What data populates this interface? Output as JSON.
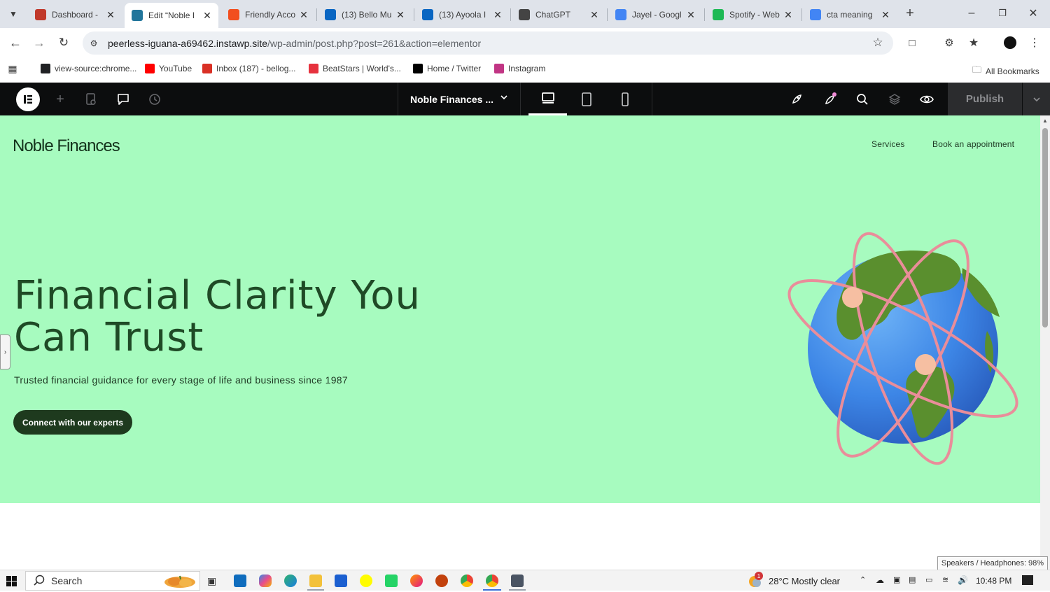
{
  "browser": {
    "tabs": [
      {
        "title": "Dashboard -",
        "icon": "wordpress-dashboard-icon",
        "color": "#c0392b"
      },
      {
        "title": "Edit “Noble I",
        "icon": "wordpress-icon",
        "color": "#21759b",
        "active": true
      },
      {
        "title": "Friendly Acco",
        "icon": "figma-icon",
        "color": "#f24e1e"
      },
      {
        "title": "(13) Bello Mu",
        "icon": "linkedin-icon",
        "color": "#0a66c2"
      },
      {
        "title": "(13) Ayoola I",
        "icon": "linkedin-icon",
        "color": "#0a66c2"
      },
      {
        "title": "ChatGPT",
        "icon": "chatgpt-icon",
        "color": "#444444"
      },
      {
        "title": "Jayel - Googl",
        "icon": "google-docs-icon",
        "color": "#4285f4"
      },
      {
        "title": "Spotify - Web",
        "icon": "spotify-icon",
        "color": "#1db954"
      },
      {
        "title": "cta meaning",
        "icon": "google-icon",
        "color": "#4285f4"
      }
    ],
    "url_host": "peerless-iguana-a69462.instawp.site",
    "url_path": "/wp-admin/post.php?post=261&action=elementor",
    "bookmarks": [
      {
        "label": "view-source:chrome...",
        "color": "#202124"
      },
      {
        "label": "YouTube",
        "color": "#ff0000"
      },
      {
        "label": "Inbox (187) - bellog...",
        "color": "#d93025"
      },
      {
        "label": "BeatStars | World's...",
        "color": "#e6323e"
      },
      {
        "label": "Home / Twitter",
        "color": "#000000"
      },
      {
        "label": "Instagram",
        "color": "#c13584"
      }
    ],
    "all_bookmarks": "All Bookmarks"
  },
  "elementor": {
    "document_name": "Noble Finances ...",
    "publish_label": "Publish"
  },
  "site": {
    "logo": "Noble Finances",
    "nav": [
      "Services",
      "Book an appointment"
    ],
    "headline": "Financial Clarity You Can Trust",
    "subheading": "Trusted financial guidance for every stage of life and business since 1987",
    "cta_label": "Connect with our experts",
    "hero_bg": "#a7fbbf",
    "cta_bg": "#1e3a1e"
  },
  "taskbar": {
    "search_label": "Search",
    "weather": "28°C  Mostly clear",
    "weather_badge": "1",
    "time": "10:48 PM",
    "tooltip": "Speakers / Headphones: 98%"
  }
}
